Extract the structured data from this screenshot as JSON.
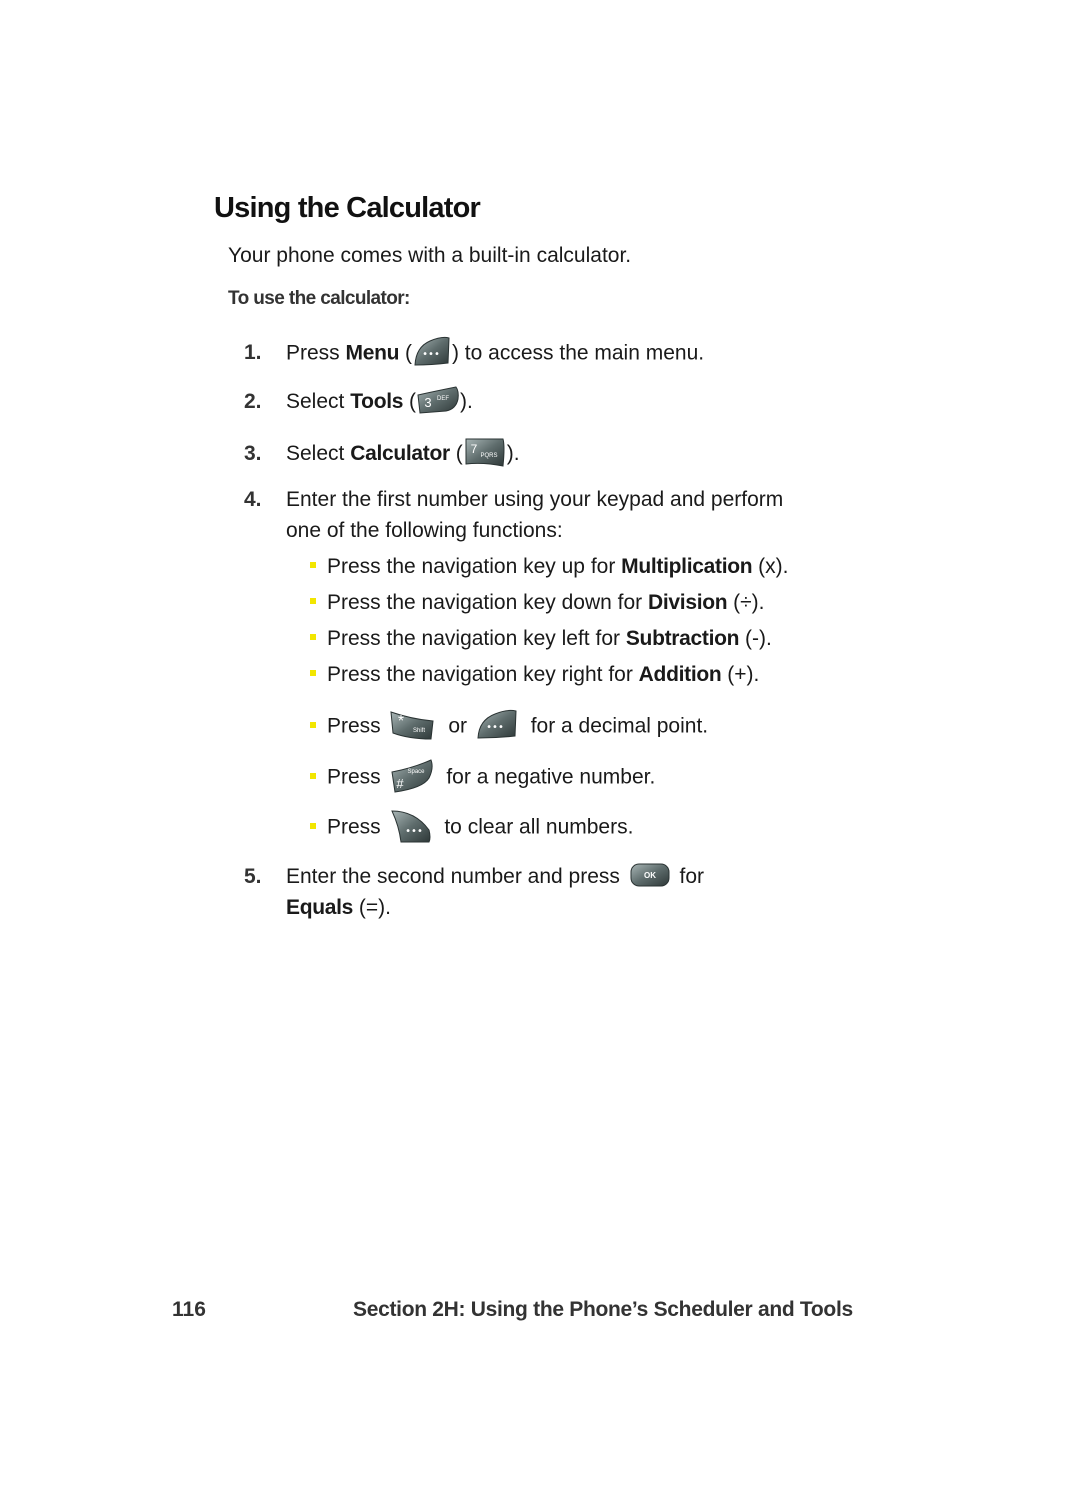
{
  "page": {
    "title": "Using the Calculator",
    "intro": "Your phone comes with a built-in calculator.",
    "subheading": "To use the calculator:",
    "steps": [
      {
        "num": "1.",
        "pre": "Press ",
        "bold": "Menu",
        "mid": " (",
        "post": ") to access the main menu.",
        "key": "menu-softkey-icon"
      },
      {
        "num": "2.",
        "pre": "Select ",
        "bold": "Tools",
        "mid": " (",
        "post": ").",
        "key": "key-3-def-icon",
        "key_label": "3",
        "key_sub": "DEF"
      },
      {
        "num": "3.",
        "pre": "Select ",
        "bold": "Calculator",
        "mid": " (",
        "post": ").",
        "key": "key-7-pqrs-icon",
        "key_label": "7",
        "key_sub": "PQRS"
      },
      {
        "num": "4.",
        "line1": "Enter the first number using your keypad and perform",
        "line2": "one of the following functions:"
      },
      {
        "num": "5.",
        "pre": "Enter the second number and press ",
        "post": " for",
        "key": "ok-key-icon",
        "key_label": "OK",
        "bold": "Equals",
        "tail": " (=)."
      }
    ],
    "bullets": [
      {
        "pre": "Press the navigation key up for ",
        "bold": "Multiplication",
        "post": " (x)."
      },
      {
        "pre": "Press the navigation key down for ",
        "bold": "Division",
        "post": " (÷)."
      },
      {
        "pre": "Press the navigation key left for ",
        "bold": "Subtraction",
        "post": " (-)."
      },
      {
        "pre": "Press the navigation key right for ",
        "bold": "Addition",
        "post": " (+)."
      },
      {
        "pre": "Press ",
        "or": " or ",
        "post": " for a decimal point.",
        "key1_label": "*",
        "key1_sub": "Shift"
      },
      {
        "pre": "Press ",
        "post": " for a negative number.",
        "key_label": "#",
        "key_sub": "Space"
      },
      {
        "pre": "Press ",
        "post": " to clear all numbers."
      }
    ],
    "footer": {
      "page_number": "116",
      "section": "Section 2H: Using the Phone’s Scheduler and Tools"
    },
    "colors": {
      "bullet": "#f2e600",
      "key_dark": "#3a4444",
      "key_light": "#8fa0a0"
    }
  }
}
